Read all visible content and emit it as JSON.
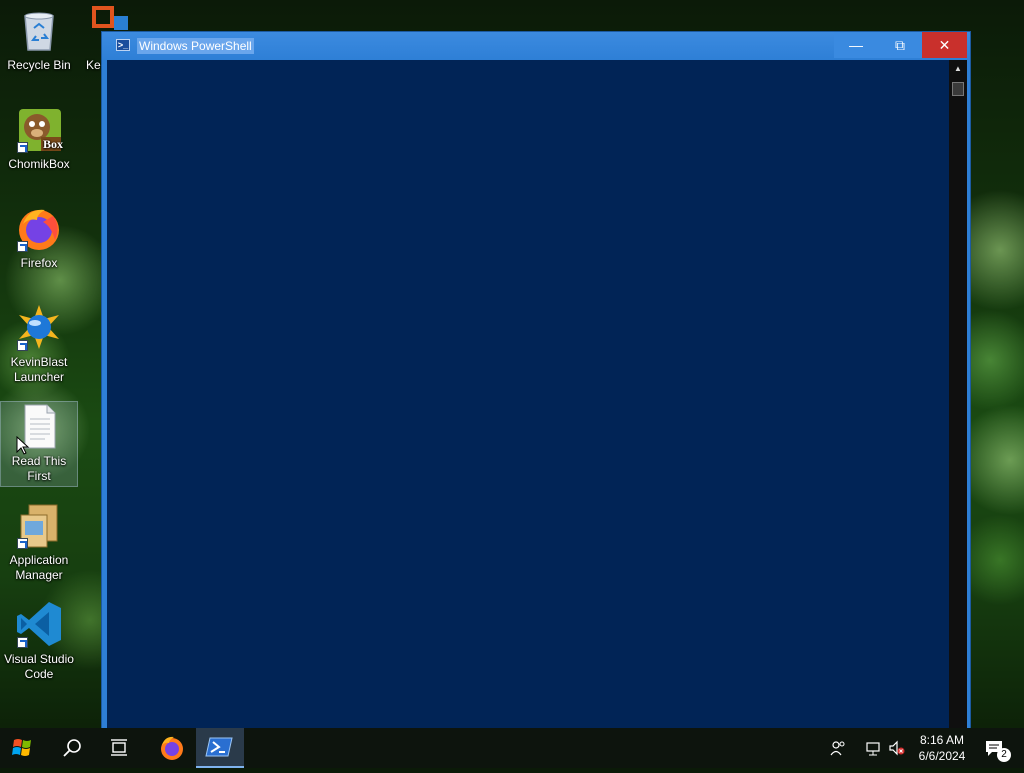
{
  "desktop": {
    "icons": [
      {
        "label": "Recycle Bin",
        "icon": "recycle-bin-icon"
      },
      {
        "label": "Ke",
        "icon": "app-icon"
      },
      {
        "label": "ChomikBox",
        "icon": "chomikbox-icon"
      },
      {
        "label": "Firefox",
        "icon": "firefox-icon"
      },
      {
        "label": "KevinBlast Launcher",
        "icon": "kevinblast-icon"
      },
      {
        "label": "Read This First",
        "icon": "text-document-icon"
      },
      {
        "label": "Application Manager",
        "icon": "application-manager-icon"
      },
      {
        "label": "Visual Studio Code",
        "icon": "vscode-icon"
      }
    ],
    "chomikbox_badge": "Box"
  },
  "window": {
    "title": "Windows PowerShell",
    "minimize_glyph": "—",
    "maximize_glyph": "⧉",
    "close_glyph": "✕",
    "console_bg": "#012456"
  },
  "taskbar": {
    "items": [
      {
        "name": "start-button",
        "icon": "windows-logo-icon"
      },
      {
        "name": "search-button",
        "icon": "search-icon"
      },
      {
        "name": "task-view-button",
        "icon": "task-view-icon"
      },
      {
        "name": "firefox-taskbar",
        "icon": "firefox-icon"
      },
      {
        "name": "powershell-taskbar",
        "icon": "powershell-icon"
      }
    ],
    "clock": {
      "time": "8:16 AM",
      "date": "6/6/2024"
    },
    "notification_count": "2"
  },
  "colors": {
    "titlebar": "#2e7fd6",
    "close": "#c9302c",
    "taskbar": "#0d140d"
  }
}
